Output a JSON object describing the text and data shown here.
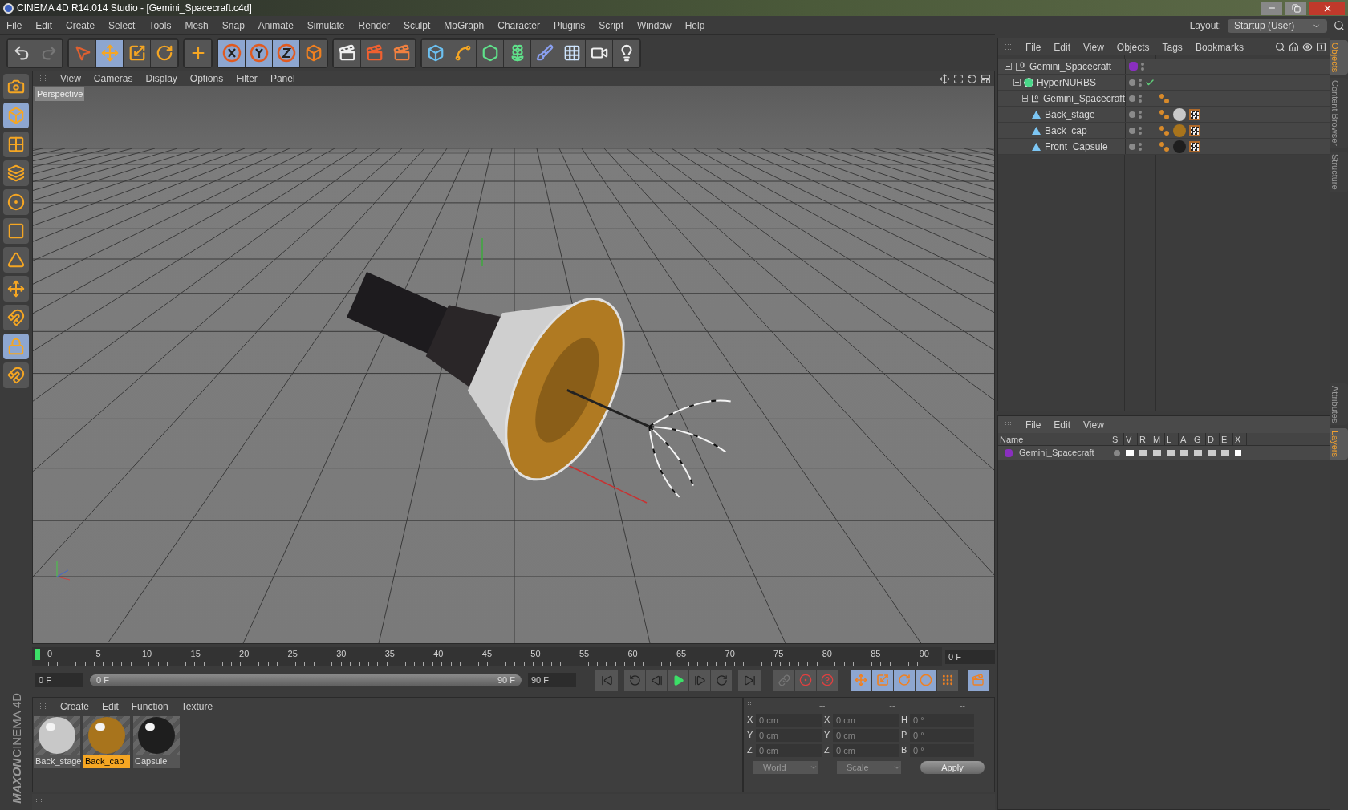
{
  "window": {
    "title": "CINEMA 4D R14.014 Studio - [Gemini_Spacecraft.c4d]"
  },
  "menu": [
    "File",
    "Edit",
    "Create",
    "Select",
    "Tools",
    "Mesh",
    "Snap",
    "Animate",
    "Simulate",
    "Render",
    "Sculpt",
    "MoGraph",
    "Character",
    "Plugins",
    "Script",
    "Window",
    "Help"
  ],
  "layout": {
    "label": "Layout:",
    "value": "Startup (User)"
  },
  "toolbar": [
    [
      {
        "kind": "undo",
        "selected": false
      },
      {
        "kind": "redo",
        "selected": false
      }
    ],
    [
      {
        "kind": "select",
        "selected": false
      },
      {
        "kind": "move",
        "selected": true
      },
      {
        "kind": "scale",
        "selected": false
      },
      {
        "kind": "rotate",
        "selected": false
      }
    ],
    [
      {
        "kind": "add",
        "selected": false
      }
    ],
    [
      {
        "kind": "x-axis",
        "selected": true
      },
      {
        "kind": "y-axis",
        "selected": true
      },
      {
        "kind": "z-axis",
        "selected": true
      },
      {
        "kind": "coords",
        "selected": false
      }
    ],
    [
      {
        "kind": "render-view",
        "selected": false
      },
      {
        "kind": "render-picture",
        "selected": false
      },
      {
        "kind": "render-settings",
        "selected": false
      }
    ],
    [
      {
        "kind": "cube",
        "selected": false
      },
      {
        "kind": "spline",
        "selected": false
      },
      {
        "kind": "nurbs",
        "selected": false
      },
      {
        "kind": "cloner",
        "selected": false
      },
      {
        "kind": "deformer",
        "selected": false
      },
      {
        "kind": "floor",
        "selected": false
      },
      {
        "kind": "camera",
        "selected": false
      },
      {
        "kind": "light",
        "selected": false
      }
    ]
  ],
  "left_toolbar": [
    {
      "kind": "view-camera",
      "selected": false
    },
    {
      "kind": "model",
      "selected": true
    },
    {
      "kind": "texture",
      "selected": false
    },
    {
      "kind": "workplane",
      "selected": false
    },
    {
      "kind": "points",
      "selected": false
    },
    {
      "kind": "edges",
      "selected": false
    },
    {
      "kind": "polygons",
      "selected": false
    },
    {
      "kind": "axis",
      "selected": false
    },
    {
      "kind": "magnet",
      "selected": false
    },
    {
      "kind": "grid-lock",
      "selected": true
    },
    {
      "kind": "snap",
      "selected": false
    }
  ],
  "viewport": {
    "menu": [
      "View",
      "Cameras",
      "Display",
      "Options",
      "Filter",
      "Panel"
    ],
    "label": "Perspective"
  },
  "timeline": {
    "ticks": [
      "0",
      "5",
      "10",
      "15",
      "20",
      "25",
      "30",
      "35",
      "40",
      "45",
      "50",
      "55",
      "60",
      "65",
      "70",
      "75",
      "80",
      "85",
      "90"
    ],
    "playhead": {
      "level": 0
    },
    "current": "0 F",
    "start": "0 F",
    "range": {
      "start": "0 F",
      "end": "90 F",
      "level": 1
    },
    "end": "90 F",
    "key_buttons": [
      {
        "kind": "move",
        "selected": true
      },
      {
        "kind": "scale",
        "selected": true
      },
      {
        "kind": "rotate",
        "selected": true
      },
      {
        "kind": "param",
        "selected": true
      },
      {
        "kind": "points",
        "selected": false
      }
    ]
  },
  "materials": {
    "menu": [
      "Create",
      "Edit",
      "Function",
      "Texture"
    ],
    "items": [
      {
        "name": "Back_stage",
        "color": "#c8c8c8",
        "selected": false
      },
      {
        "name": "Back_cap",
        "color": "#a8741c",
        "selected": true
      },
      {
        "name": "Capsule",
        "color": "#1e1e1e",
        "selected": false
      }
    ]
  },
  "coordinates": {
    "headers": [
      "--",
      "--",
      "--"
    ],
    "rows": [
      {
        "label": "X",
        "position": "0 cm",
        "size_label": "X",
        "size": "0 cm",
        "rotation_label": "H",
        "rotation": "0 °"
      },
      {
        "label": "Y",
        "position": "0 cm",
        "size_label": "Y",
        "size": "0 cm",
        "rotation_label": "P",
        "rotation": "0 °"
      },
      {
        "label": "Z",
        "position": "0 cm",
        "size_label": "Z",
        "size": "0 cm",
        "rotation_label": "B",
        "rotation": "0 °"
      }
    ],
    "mode": "World",
    "size_mode": "Scale",
    "apply": "Apply"
  },
  "logo": {
    "brand": "MAXON",
    "product": "CINEMA 4D"
  },
  "objects": {
    "menu": [
      "File",
      "Edit",
      "View",
      "Objects",
      "Tags",
      "Bookmarks"
    ],
    "tree": [
      {
        "name": "Gemini_Spacecraft",
        "kind": "null",
        "expanded": true,
        "color": "#8a2fc0",
        "children": [
          {
            "name": "HyperNURBS",
            "kind": "hypernurbs",
            "expanded": true,
            "enabled": true,
            "children": [
              {
                "name": "Gemini_Spacecraft",
                "kind": "null",
                "expanded": true,
                "tags": [
                  {
                    "kind": "phong"
                  }
                ],
                "children": [
                  {
                    "name": "Back_stage",
                    "kind": "polygon",
                    "tags": [
                      {
                        "kind": "phong"
                      },
                      {
                        "kind": "material",
                        "color": "#c8c8c8"
                      },
                      {
                        "kind": "texture"
                      }
                    ]
                  },
                  {
                    "name": "Back_cap",
                    "kind": "polygon",
                    "tags": [
                      {
                        "kind": "phong"
                      },
                      {
                        "kind": "material",
                        "color": "#a8741c"
                      },
                      {
                        "kind": "texture"
                      }
                    ]
                  },
                  {
                    "name": "Front_Capsule",
                    "kind": "polygon",
                    "tags": [
                      {
                        "kind": "phong"
                      },
                      {
                        "kind": "material",
                        "color": "#1e1e1e"
                      },
                      {
                        "kind": "texture"
                      }
                    ]
                  }
                ]
              }
            ]
          }
        ]
      }
    ]
  },
  "layers": {
    "menu": [
      "File",
      "Edit",
      "View"
    ],
    "columns": [
      "Name",
      "S",
      "V",
      "R",
      "M",
      "L",
      "A",
      "G",
      "D",
      "E",
      "X"
    ],
    "rows": [
      {
        "name": "Gemini_Spacecraft",
        "color": "#8a2fc0"
      }
    ]
  },
  "side_tabs_top": [
    {
      "label": "Objects",
      "selected": true
    },
    {
      "label": "Content Browser",
      "selected": false
    },
    {
      "label": "Structure",
      "selected": false
    }
  ],
  "side_tabs_bottom": [
    {
      "label": "Attributes",
      "selected": false
    },
    {
      "label": "Layers",
      "selected": true
    }
  ]
}
